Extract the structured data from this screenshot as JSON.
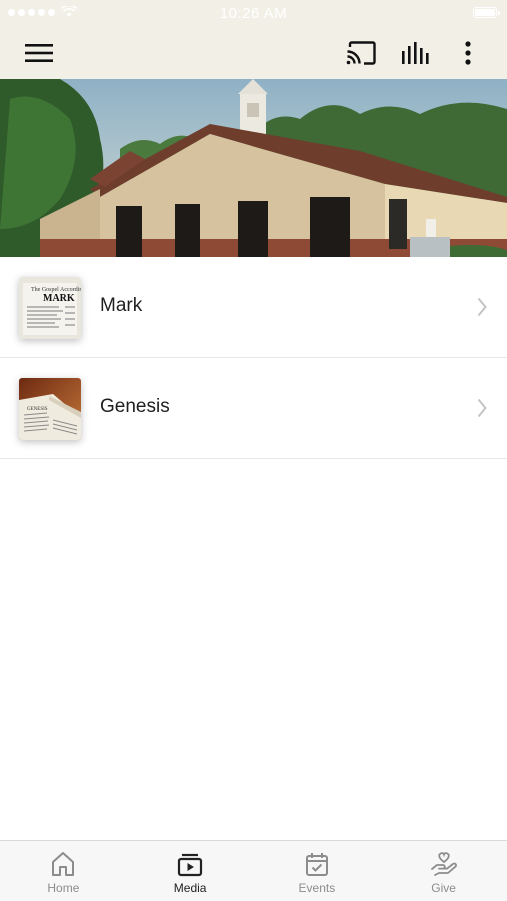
{
  "status_bar": {
    "time": "10:26 AM"
  },
  "toolbar": {
    "menu_icon": "hamburger-menu-icon",
    "cast_icon": "cast-icon",
    "bars_icon": "audio-bars-icon",
    "more_icon": "more-vertical-icon"
  },
  "hero": {
    "image": "church-building-photo"
  },
  "media_list": [
    {
      "title": "Mark",
      "thumb": "mark-gospel-page"
    },
    {
      "title": "Genesis",
      "thumb": "genesis-open-bible"
    }
  ],
  "tabbar": {
    "tabs": [
      {
        "label": "Home",
        "icon": "home-icon"
      },
      {
        "label": "Media",
        "icon": "media-icon",
        "active": true
      },
      {
        "label": "Events",
        "icon": "calendar-icon"
      },
      {
        "label": "Give",
        "icon": "give-hand-heart-icon"
      }
    ]
  },
  "colors": {
    "bar_bg": "#f1efe6",
    "tab_active": "#222222",
    "tab_inactive": "#8c8c8c"
  }
}
